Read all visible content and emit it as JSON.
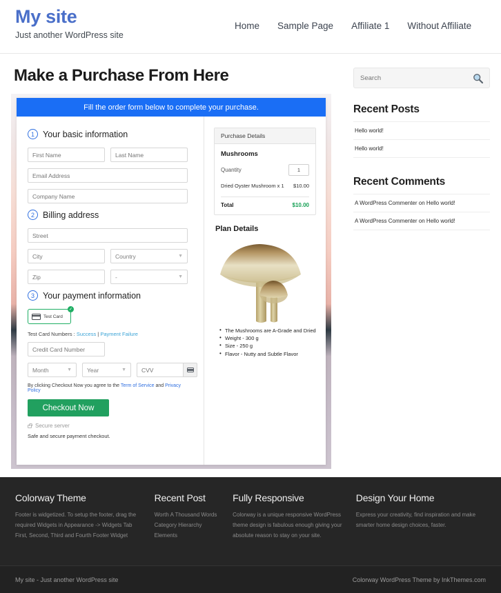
{
  "header": {
    "site_title": "My site",
    "tagline": "Just another WordPress site",
    "nav": [
      {
        "label": "Home"
      },
      {
        "label": "Sample Page"
      },
      {
        "label": "Affiliate 1"
      },
      {
        "label": "Without Affiliate"
      }
    ]
  },
  "main": {
    "page_title": "Make a Purchase From Here",
    "banner_text": "Fill the order form below to complete your purchase.",
    "steps": {
      "one_num": "1",
      "one_label": "Your basic information",
      "two_num": "2",
      "two_label": "Billing address",
      "three_num": "3",
      "three_label": "Your payment information"
    },
    "fields": {
      "first_name": "First Name",
      "last_name": "Last Name",
      "email": "Email Address",
      "company": "Company Name",
      "street": "Street",
      "city": "City",
      "country": "Country",
      "zip": "Zip",
      "state": "-",
      "credit_card": "Credit Card Number",
      "month": "Month",
      "year": "Year",
      "cvv": "CVV"
    },
    "payment": {
      "test_card_label": "Test Card",
      "test_numbers_prefix": "Test Card Numbers : ",
      "test_success": "Success",
      "test_divider": " | ",
      "test_failure": "Payment Failure",
      "terms_prefix": "By clicking Checkout Now you agree to the ",
      "terms_link": "Term of Service",
      "terms_mid": " and ",
      "privacy_link": "Privacy Policy",
      "checkout_label": "Checkout Now",
      "secure_server": "Secure server",
      "safe_note": "Safe and secure payment checkout."
    },
    "purchase_details": {
      "heading": "Purchase Details",
      "product": "Mushrooms",
      "quantity_label": "Quantity",
      "quantity_value": "1",
      "line_item_name": "Dried Oyster Mushroom x 1",
      "line_item_price": "$10.00",
      "total_label": "Total",
      "total_value": "$10.00"
    },
    "plan": {
      "title": "Plan Details",
      "image_alt": "mushroom-illustration",
      "bullets": [
        "The Mushrooms are A-Grade and Dried",
        "Weight - 300 g",
        "Size - 250 g",
        "Flavor - Nutty and Subtle Flavor"
      ]
    }
  },
  "sidebar": {
    "search_placeholder": "Search",
    "recent_posts_title": "Recent Posts",
    "recent_posts": [
      {
        "label": "Hello world!"
      },
      {
        "label": "Hello world!"
      }
    ],
    "recent_comments_title": "Recent Comments",
    "recent_comments": [
      {
        "label": "A WordPress Commenter on Hello world!"
      },
      {
        "label": "A WordPress Commenter on Hello world!"
      }
    ]
  },
  "footer": {
    "columns": [
      {
        "title": "Colorway Theme",
        "text": "Footer is widgetized. To setup the footer, drag the required Widgets in Appearance -> Widgets Tab First, Second, Third and Fourth Footer Widget"
      },
      {
        "title": "Recent Post",
        "items": [
          {
            "label": "Worth A Thousand Words"
          },
          {
            "label": "Category Hierarchy"
          },
          {
            "label": "Elements"
          }
        ]
      },
      {
        "title": "Fully Responsive",
        "text": "Colorway is a unique responsive WordPress theme design is fabulous enough giving your absolute reason to stay on your site."
      },
      {
        "title": "Design Your Home",
        "text": "Express your creativity, find inspiration and make smarter home design choices, faster."
      }
    ],
    "bottom_left": "My site - Just another WordPress site",
    "bottom_right": "Colorway WordPress Theme by InkThemes.com"
  },
  "colors": {
    "brand_blue": "#4a6fc9",
    "banner_blue": "#1a6ef5",
    "accent_green": "#21a05f",
    "total_green": "#17a055",
    "link_blue": "#2f6fe0",
    "footer_dark": "#262626"
  }
}
